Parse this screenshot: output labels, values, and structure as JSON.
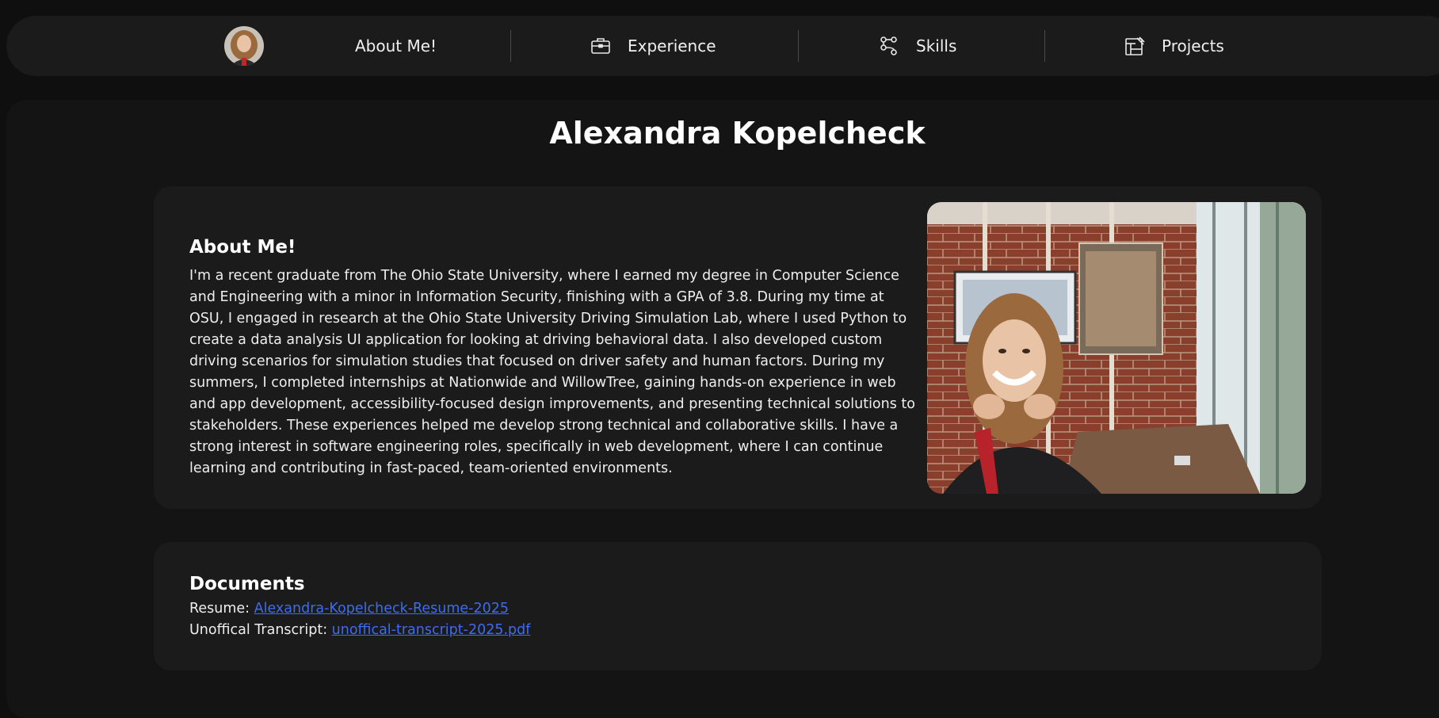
{
  "nav": {
    "items": [
      {
        "label": "About Me!",
        "icon": "none"
      },
      {
        "label": "Experience",
        "icon": "briefcase-icon"
      },
      {
        "label": "Skills",
        "icon": "skills-diagram-icon"
      },
      {
        "label": "Projects",
        "icon": "projects-board-icon"
      }
    ]
  },
  "page": {
    "title": "Alexandra Kopelcheck"
  },
  "about": {
    "heading": "About Me!",
    "text": "I'm a recent graduate from The Ohio State University, where I earned my degree in Computer Science and Engineering with a minor in Information Security, finishing with a GPA of 3.8. During my time at OSU, I engaged in research at the Ohio State University Driving Simulation Lab, where I used Python to create a data analysis UI application for looking at driving behavioral data. I also developed custom driving scenarios for simulation studies that focused on driver safety and human factors. During my summers, I completed internships at Nationwide and WillowTree, gaining hands-on experience in web and app development, accessibility-focused design improvements, and presenting technical solutions to stakeholders. These experiences helped me develop strong technical and collaborative skills. I have a strong interest in software engineering roles, specifically in web development, where I can continue learning and contributing in fast-paced, team-oriented environments."
  },
  "documents": {
    "heading": "Documents",
    "resume_label": "Resume: ",
    "resume_link": "Alexandra-Kopelcheck-Resume-2025",
    "transcript_label": "Unoffical Transcript: ",
    "transcript_link": "unoffical-transcript-2025.pdf"
  },
  "colors": {
    "background": "#0f0f0f",
    "card": "#1b1b1b",
    "link": "#3d6cf0"
  }
}
